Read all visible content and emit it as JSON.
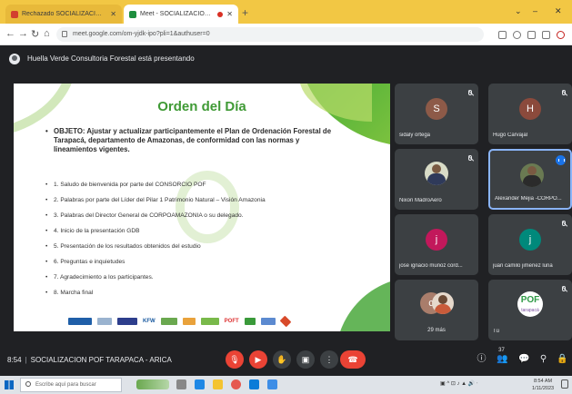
{
  "browser": {
    "tabs": [
      {
        "label": "Rechazado SOCIALIZACION PO",
        "close": "✕"
      },
      {
        "label": "Meet - SOCIALIZACION PO",
        "close": "✕"
      }
    ],
    "new_tab": "+",
    "url": "meet.google.com/om-yjdk-ipo?pli=1&authuser=0",
    "window_controls": [
      "⌄",
      "–",
      "✕"
    ]
  },
  "meet": {
    "presenting_text": "Huella Verde Consultoria Forestal está presentando",
    "slide": {
      "title": "Orden del Día",
      "objective": "OBJETO: Ajustar y actualizar participantemente el Plan de Ordenación Forestal de Tarapacá, departamento de Amazonas, de conformidad con las normas y lineamientos vigentes.",
      "agenda": [
        "1. Saludo de bienvenida por parte del CONSORCIO POF",
        "2. Palabras por parte del Líder del Pilar 1 Patrimonio Natural – Visión Amazonia",
        "3. Palabras del Director General de CORPOAMAZONIA o su delegado.",
        "4. Inicio de la presentación GDB",
        "5. Presentación de los resultados obtenidos del estudio",
        "6. Preguntas e inquietudes",
        "7. Agradecimiento a los participantes.",
        "8. Marcha final"
      ],
      "logos": [
        "KFW",
        "POFT"
      ]
    },
    "participants": [
      {
        "name": "sidaly ortega",
        "initial": "S",
        "color": "#8d5a48"
      },
      {
        "name": "Hugo Carvajal",
        "initial": "H",
        "color": "#8b4a3c"
      },
      {
        "name": "Nixon MadroAero",
        "photo": true
      },
      {
        "name": "Alexander Mejia -CORPO...",
        "photo": true,
        "speaking": true
      },
      {
        "name": "jose ignacio munoz cord...",
        "initial": "j",
        "color": "#c2185b"
      },
      {
        "name": "juan camilo jimenez luna",
        "initial": "j",
        "color": "#00897b"
      },
      {
        "count": "29 más",
        "initial": "c"
      },
      {
        "name": "Tú",
        "logo": "POF",
        "logo_sub": "tarapacá"
      }
    ],
    "bottom": {
      "time": "8:54",
      "meeting_name": "SOCIALIZACION POF TARAPACA - ARICA",
      "participants_badge": "37"
    }
  },
  "taskbar": {
    "search_placeholder": "Escribe aquí para buscar",
    "clock_time": "8:54 AM",
    "clock_date": "1/11/2023"
  }
}
